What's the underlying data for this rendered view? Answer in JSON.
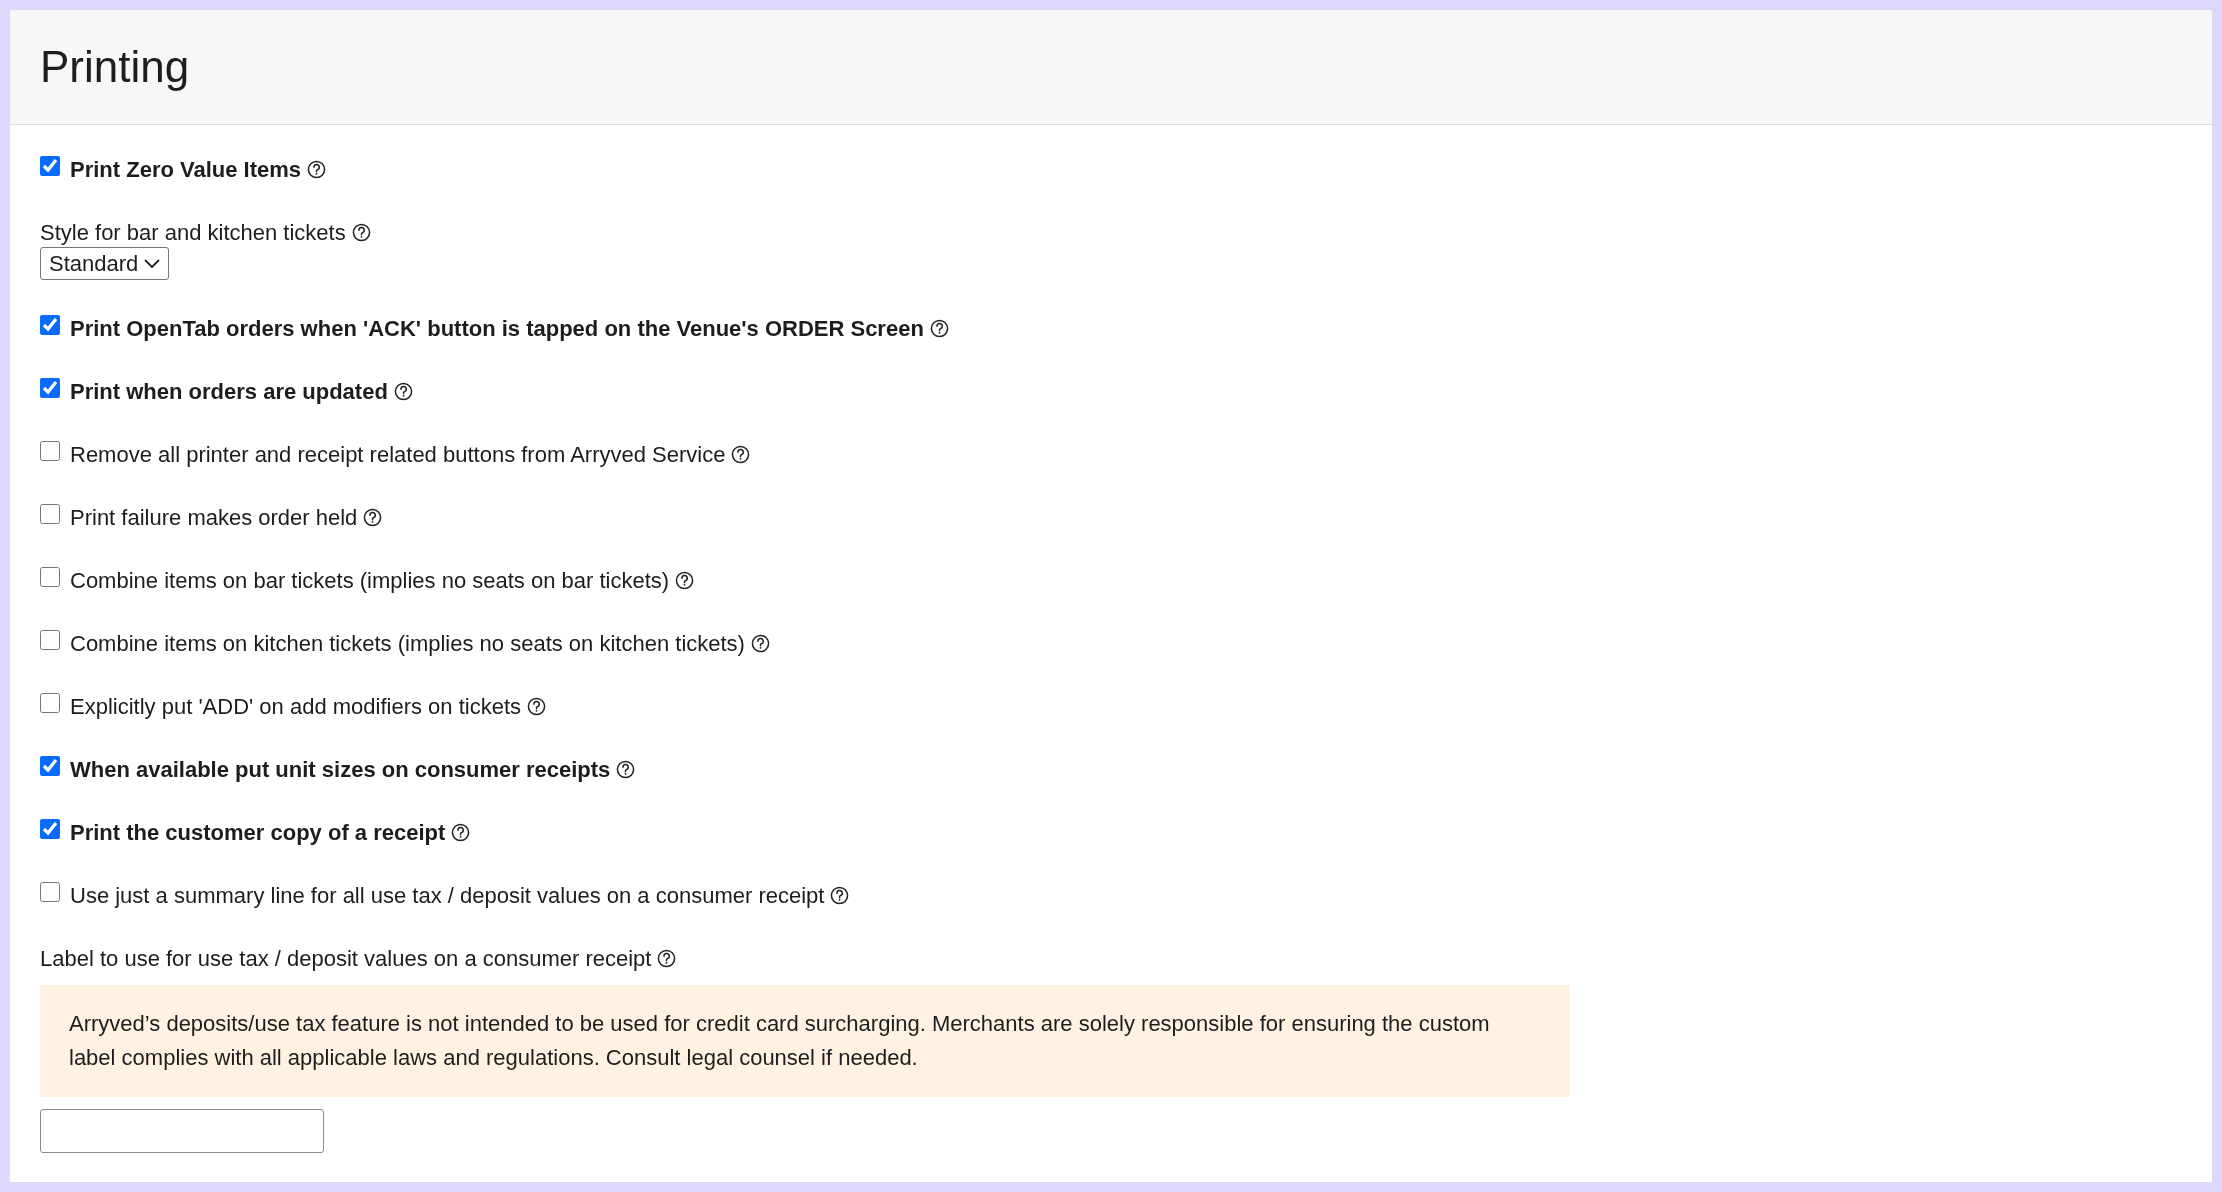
{
  "title": "Printing",
  "settings": [
    {
      "kind": "checkbox",
      "label": "Print Zero Value Items",
      "checked": true
    },
    {
      "kind": "select",
      "label": "Style for bar and kitchen tickets",
      "value": "Standard"
    },
    {
      "kind": "checkbox",
      "label": "Print OpenTab orders when 'ACK' button is tapped on the Venue's ORDER Screen",
      "checked": true
    },
    {
      "kind": "checkbox",
      "label": "Print when orders are updated",
      "checked": true
    },
    {
      "kind": "checkbox",
      "label": "Remove all printer and receipt related buttons from Arryved Service",
      "checked": false
    },
    {
      "kind": "checkbox",
      "label": "Print failure makes order held",
      "checked": false
    },
    {
      "kind": "checkbox",
      "label": "Combine items on bar tickets (implies no seats on bar tickets)",
      "checked": false
    },
    {
      "kind": "checkbox",
      "label": "Combine items on kitchen tickets (implies no seats on kitchen tickets)",
      "checked": false
    },
    {
      "kind": "checkbox",
      "label": "Explicitly put 'ADD' on add modifiers on tickets",
      "checked": false
    },
    {
      "kind": "checkbox",
      "label": "When available put unit sizes on consumer receipts",
      "checked": true
    },
    {
      "kind": "checkbox",
      "label": "Print the customer copy of a receipt",
      "checked": true
    },
    {
      "kind": "checkbox",
      "label": "Use just a summary line for all use tax / deposit values on a consumer receipt",
      "checked": false
    },
    {
      "kind": "text_input",
      "label": "Label to use for use tax / deposit values on a consumer receipt",
      "notice": "Arryved’s deposits/use tax feature is not intended to be used for credit card surcharging. Merchants are solely responsible for ensuring the custom label complies with all applicable laws and regulations. Consult legal counsel if needed."
    }
  ]
}
